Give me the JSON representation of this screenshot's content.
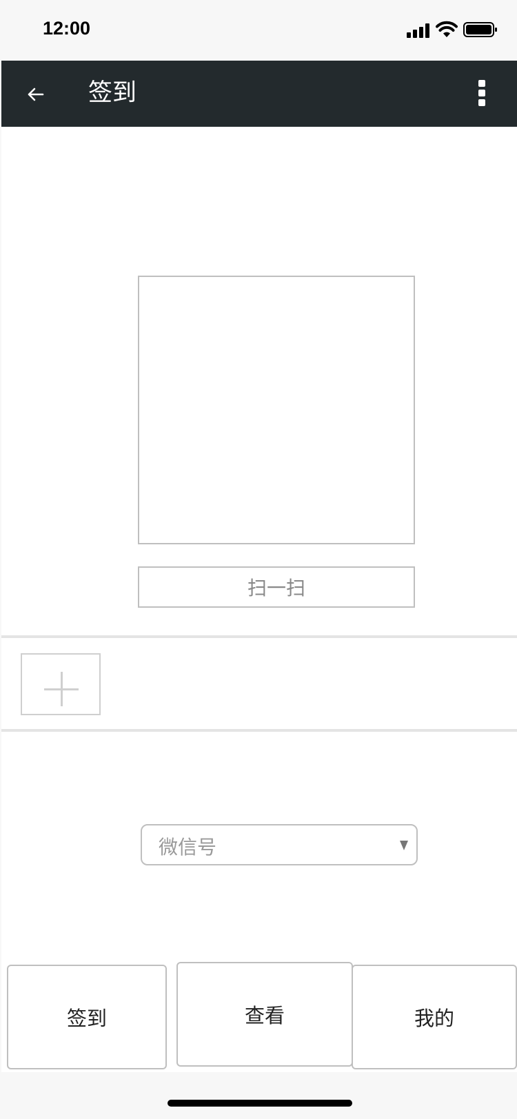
{
  "status_bar": {
    "time": "12:00"
  },
  "header": {
    "title": "签到"
  },
  "scan": {
    "button_label": "扫一扫"
  },
  "wechat_select": {
    "placeholder": "微信号"
  },
  "bottom_nav": {
    "items": [
      {
        "label": "签到"
      },
      {
        "label": "查看"
      },
      {
        "label": "我的"
      }
    ]
  },
  "colors": {
    "app_bar": "#232a2d",
    "border": "#bfbfbf",
    "divider": "#e4e4e4"
  },
  "icons": [
    "back-arrow-icon",
    "more-vert-icon",
    "plus-icon",
    "dropdown-icon",
    "signal-icon",
    "wifi-icon",
    "battery-icon"
  ]
}
